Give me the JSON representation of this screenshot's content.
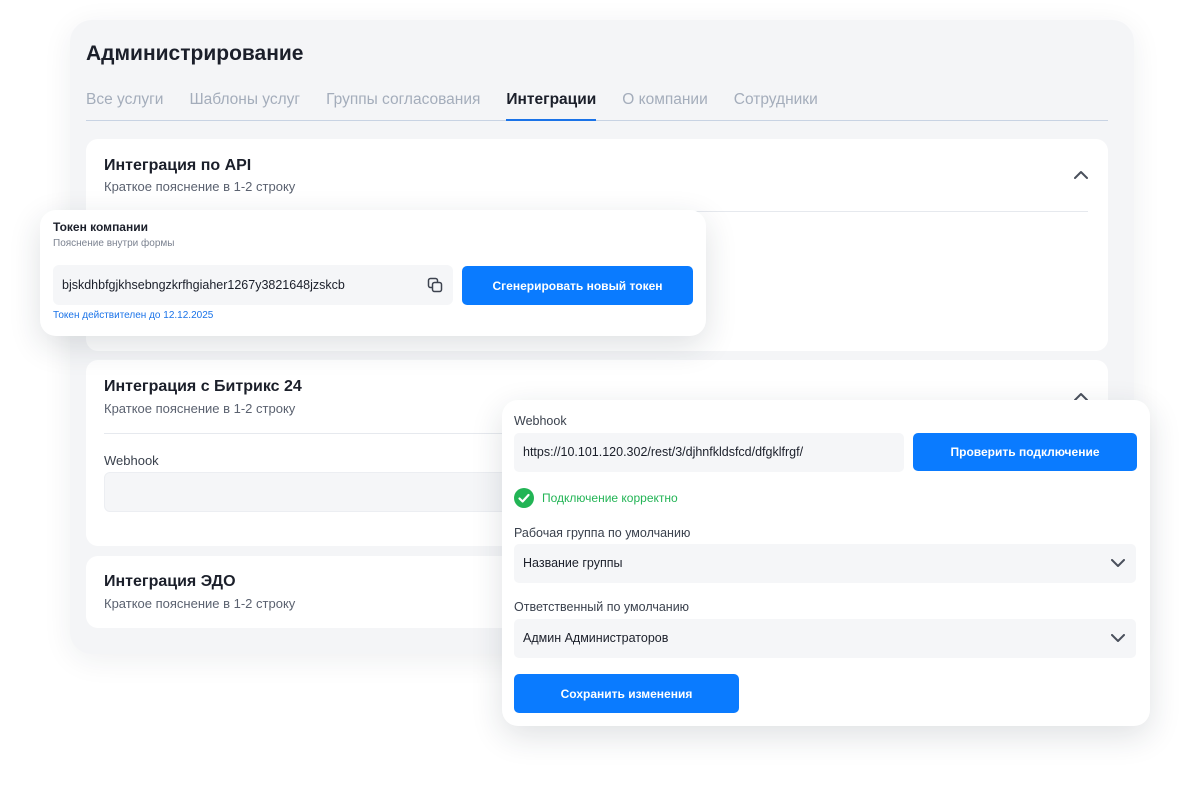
{
  "page": {
    "title": "Администрирование",
    "tabs": [
      {
        "label": "Все услуги"
      },
      {
        "label": "Шаблоны услуг"
      },
      {
        "label": "Группы согласования"
      },
      {
        "label": "Интеграции",
        "active": true
      },
      {
        "label": "О компании"
      },
      {
        "label": "Сотрудники"
      }
    ]
  },
  "sections": {
    "api": {
      "title": "Интеграция по API",
      "subtitle": "Краткое пояснение в 1-2 строку"
    },
    "bitrix": {
      "title": "Интеграция с Битрикс 24",
      "subtitle": "Краткое пояснение в 1-2 строку",
      "webhook_label": "Webhook"
    },
    "edo": {
      "title": "Интеграция ЭДО",
      "subtitle": "Краткое пояснение в 1-2 строку"
    }
  },
  "token": {
    "title": "Токен компании",
    "hint": "Пояснение внутри формы",
    "value": "bjskdhbfgjkhsebngzkrfhgiaher1267y3821648jzskcb",
    "generate_label": "Сгенерировать новый токен",
    "valid_until": "Токен действителен до 12.12.2025",
    "icons": {
      "copy": "copy-icon"
    }
  },
  "webhook": {
    "label": "Webhook",
    "url": "https://10.101.120.302/rest/3/djhnfkldsfcd/dfgklfrgf/",
    "check_label": "Проверить подключение",
    "status": "Подключение корректно",
    "group_label": "Рабочая группа по умолчанию",
    "group_value": "Название группы",
    "responsible_label": "Ответственный по умолчанию",
    "responsible_value": "Админ Администраторов",
    "save_label": "Сохранить изменения"
  },
  "colors": {
    "accent": "#0a7bff",
    "success": "#22b455",
    "tab_inactive": "#a4adbb",
    "link": "#1a73e8"
  }
}
